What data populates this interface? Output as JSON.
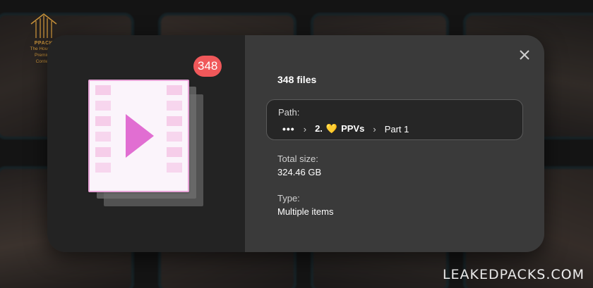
{
  "logo": {
    "brand": "PPACK",
    "tagline_lines": [
      "The House of",
      "Premium",
      "Content"
    ]
  },
  "watermark": "LEAKEDPACKS.COM",
  "modal": {
    "count_badge": "348",
    "title": "348 files",
    "path": {
      "label": "Path:",
      "ellipsis": "•••",
      "crumb_2_prefix": "2.",
      "crumb_2_emoji": "💛",
      "crumb_2_name": "PPVs",
      "crumb_3": "Part 1"
    },
    "total_size": {
      "label": "Total size:",
      "value": "324.46 GB"
    },
    "type": {
      "label": "Type:",
      "value": "Multiple items"
    }
  },
  "colors": {
    "badge": "#f0585a",
    "play_icon": "#e16ed2",
    "logo_gold": "#c8923a"
  }
}
